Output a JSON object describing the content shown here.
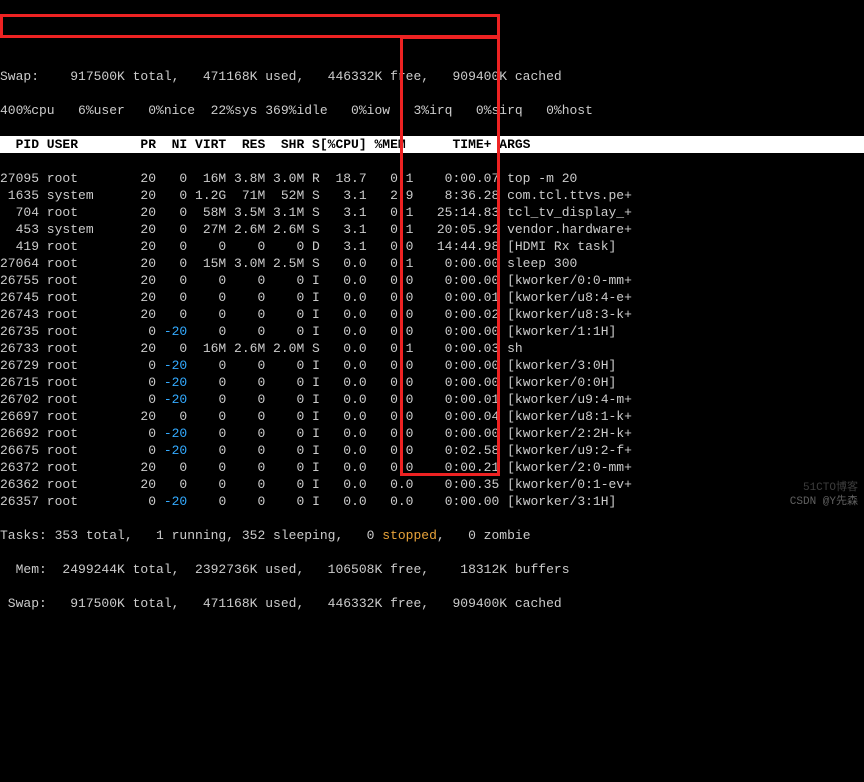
{
  "swap_top": "Swap:    917500K total,   471168K used,   446332K free,   909400K cached",
  "cpu_line": {
    "pref": "400%cpu   6%user   0%nice  22%sys 369%idle   0%iow",
    "rest": "   3%irq   0%sirq   0%host"
  },
  "headers": {
    "pid": "  PID",
    "user": "USER",
    "pr": "PR",
    "ni": "NI",
    "virt": "VIRT",
    "res": "RES",
    "shr": "SHR",
    "s": "S",
    "cpu": "[%CPU]",
    "mem": "%MEM",
    "time": "TIME+",
    "args": "ARGS"
  },
  "rows": [
    {
      "pid": "27095",
      "user": "root",
      "pr": "20",
      "ni": "0",
      "virt": "16M",
      "res": "3.8M",
      "shr": "3.0M",
      "s": "R",
      "cpu": "18.7",
      "mem": "0.1",
      "time": "0:00.07",
      "args": "top -m 20"
    },
    {
      "pid": " 1635",
      "user": "system",
      "pr": "20",
      "ni": "0",
      "virt": "1.2G",
      "res": "71M",
      "shr": "52M",
      "s": "S",
      "cpu": " 3.1",
      "mem": "2.9",
      "time": "8:36.28",
      "args": "com.tcl.ttvs.pe+"
    },
    {
      "pid": "  704",
      "user": "root",
      "pr": "20",
      "ni": "0",
      "virt": "58M",
      "res": "3.5M",
      "shr": "3.1M",
      "s": "S",
      "cpu": " 3.1",
      "mem": "0.1",
      "time": "25:14.83",
      "args": "tcl_tv_display_+"
    },
    {
      "pid": "  453",
      "user": "system",
      "pr": "20",
      "ni": "0",
      "virt": "27M",
      "res": "2.6M",
      "shr": "2.6M",
      "s": "S",
      "cpu": " 3.1",
      "mem": "0.1",
      "time": "20:05.92",
      "args": "vendor.hardware+"
    },
    {
      "pid": "  419",
      "user": "root",
      "pr": "20",
      "ni": "0",
      "virt": "0",
      "res": "0",
      "shr": "0",
      "s": "D",
      "cpu": " 3.1",
      "mem": "0.0",
      "time": "14:44.98",
      "args": "[HDMI Rx task]"
    },
    {
      "pid": "27064",
      "user": "root",
      "pr": "20",
      "ni": "0",
      "virt": "15M",
      "res": "3.0M",
      "shr": "2.5M",
      "s": "S",
      "cpu": " 0.0",
      "mem": "0.1",
      "time": "0:00.00",
      "args": "sleep 300"
    },
    {
      "pid": "26755",
      "user": "root",
      "pr": "20",
      "ni": "0",
      "virt": "0",
      "res": "0",
      "shr": "0",
      "s": "I",
      "cpu": " 0.0",
      "mem": "0.0",
      "time": "0:00.00",
      "args": "[kworker/0:0-mm+"
    },
    {
      "pid": "26745",
      "user": "root",
      "pr": "20",
      "ni": "0",
      "virt": "0",
      "res": "0",
      "shr": "0",
      "s": "I",
      "cpu": " 0.0",
      "mem": "0.0",
      "time": "0:00.01",
      "args": "[kworker/u8:4-e+"
    },
    {
      "pid": "26743",
      "user": "root",
      "pr": "20",
      "ni": "0",
      "virt": "0",
      "res": "0",
      "shr": "0",
      "s": "I",
      "cpu": " 0.0",
      "mem": "0.0",
      "time": "0:00.02",
      "args": "[kworker/u8:3-k+"
    },
    {
      "pid": "26735",
      "user": "root",
      "pr": "0",
      "ni": "-20",
      "virt": "0",
      "res": "0",
      "shr": "0",
      "s": "I",
      "cpu": " 0.0",
      "mem": "0.0",
      "time": "0:00.00",
      "args": "[kworker/1:1H]"
    },
    {
      "pid": "26733",
      "user": "root",
      "pr": "20",
      "ni": "0",
      "virt": "16M",
      "res": "2.6M",
      "shr": "2.0M",
      "s": "S",
      "cpu": " 0.0",
      "mem": "0.1",
      "time": "0:00.03",
      "args": "sh"
    },
    {
      "pid": "26729",
      "user": "root",
      "pr": "0",
      "ni": "-20",
      "virt": "0",
      "res": "0",
      "shr": "0",
      "s": "I",
      "cpu": " 0.0",
      "mem": "0.0",
      "time": "0:00.00",
      "args": "[kworker/3:0H]"
    },
    {
      "pid": "26715",
      "user": "root",
      "pr": "0",
      "ni": "-20",
      "virt": "0",
      "res": "0",
      "shr": "0",
      "s": "I",
      "cpu": " 0.0",
      "mem": "0.0",
      "time": "0:00.00",
      "args": "[kworker/0:0H]"
    },
    {
      "pid": "26702",
      "user": "root",
      "pr": "0",
      "ni": "-20",
      "virt": "0",
      "res": "0",
      "shr": "0",
      "s": "I",
      "cpu": " 0.0",
      "mem": "0.0",
      "time": "0:00.01",
      "args": "[kworker/u9:4-m+"
    },
    {
      "pid": "26697",
      "user": "root",
      "pr": "20",
      "ni": "0",
      "virt": "0",
      "res": "0",
      "shr": "0",
      "s": "I",
      "cpu": " 0.0",
      "mem": "0.0",
      "time": "0:00.04",
      "args": "[kworker/u8:1-k+"
    },
    {
      "pid": "26692",
      "user": "root",
      "pr": "0",
      "ni": "-20",
      "virt": "0",
      "res": "0",
      "shr": "0",
      "s": "I",
      "cpu": " 0.0",
      "mem": "0.0",
      "time": "0:00.00",
      "args": "[kworker/2:2H-k+"
    },
    {
      "pid": "26675",
      "user": "root",
      "pr": "0",
      "ni": "-20",
      "virt": "0",
      "res": "0",
      "shr": "0",
      "s": "I",
      "cpu": " 0.0",
      "mem": "0.0",
      "time": "0:02.58",
      "args": "[kworker/u9:2-f+"
    },
    {
      "pid": "26372",
      "user": "root",
      "pr": "20",
      "ni": "0",
      "virt": "0",
      "res": "0",
      "shr": "0",
      "s": "I",
      "cpu": " 0.0",
      "mem": "0.0",
      "time": "0:00.21",
      "args": "[kworker/2:0-mm+"
    },
    {
      "pid": "26362",
      "user": "root",
      "pr": "20",
      "ni": "0",
      "virt": "0",
      "res": "0",
      "shr": "0",
      "s": "I",
      "cpu": " 0.0",
      "mem": "0.0",
      "time": "0:00.35",
      "args": "[kworker/0:1-ev+"
    },
    {
      "pid": "26357",
      "user": "root",
      "pr": "0",
      "ni": "-20",
      "virt": "0",
      "res": "0",
      "shr": "0",
      "s": "I",
      "cpu": " 0.0",
      "mem": "0.0",
      "time": "0:00.00",
      "args": "[kworker/3:1H]"
    }
  ],
  "tasks": {
    "pref": "Tasks: 353 total,   1 running, 352 sleeping,   0 ",
    "stopped": "stopped",
    "rest": ",   0 zombie"
  },
  "mem": "  Mem:  2499244K total,  2392736K used,   106508K free,    18312K buffers",
  "swap": " Swap:   917500K total,   471168K used,   446332K free,   909400K cached",
  "watermark": "51CTO博客",
  "csdn": "CSDN @Y先森"
}
